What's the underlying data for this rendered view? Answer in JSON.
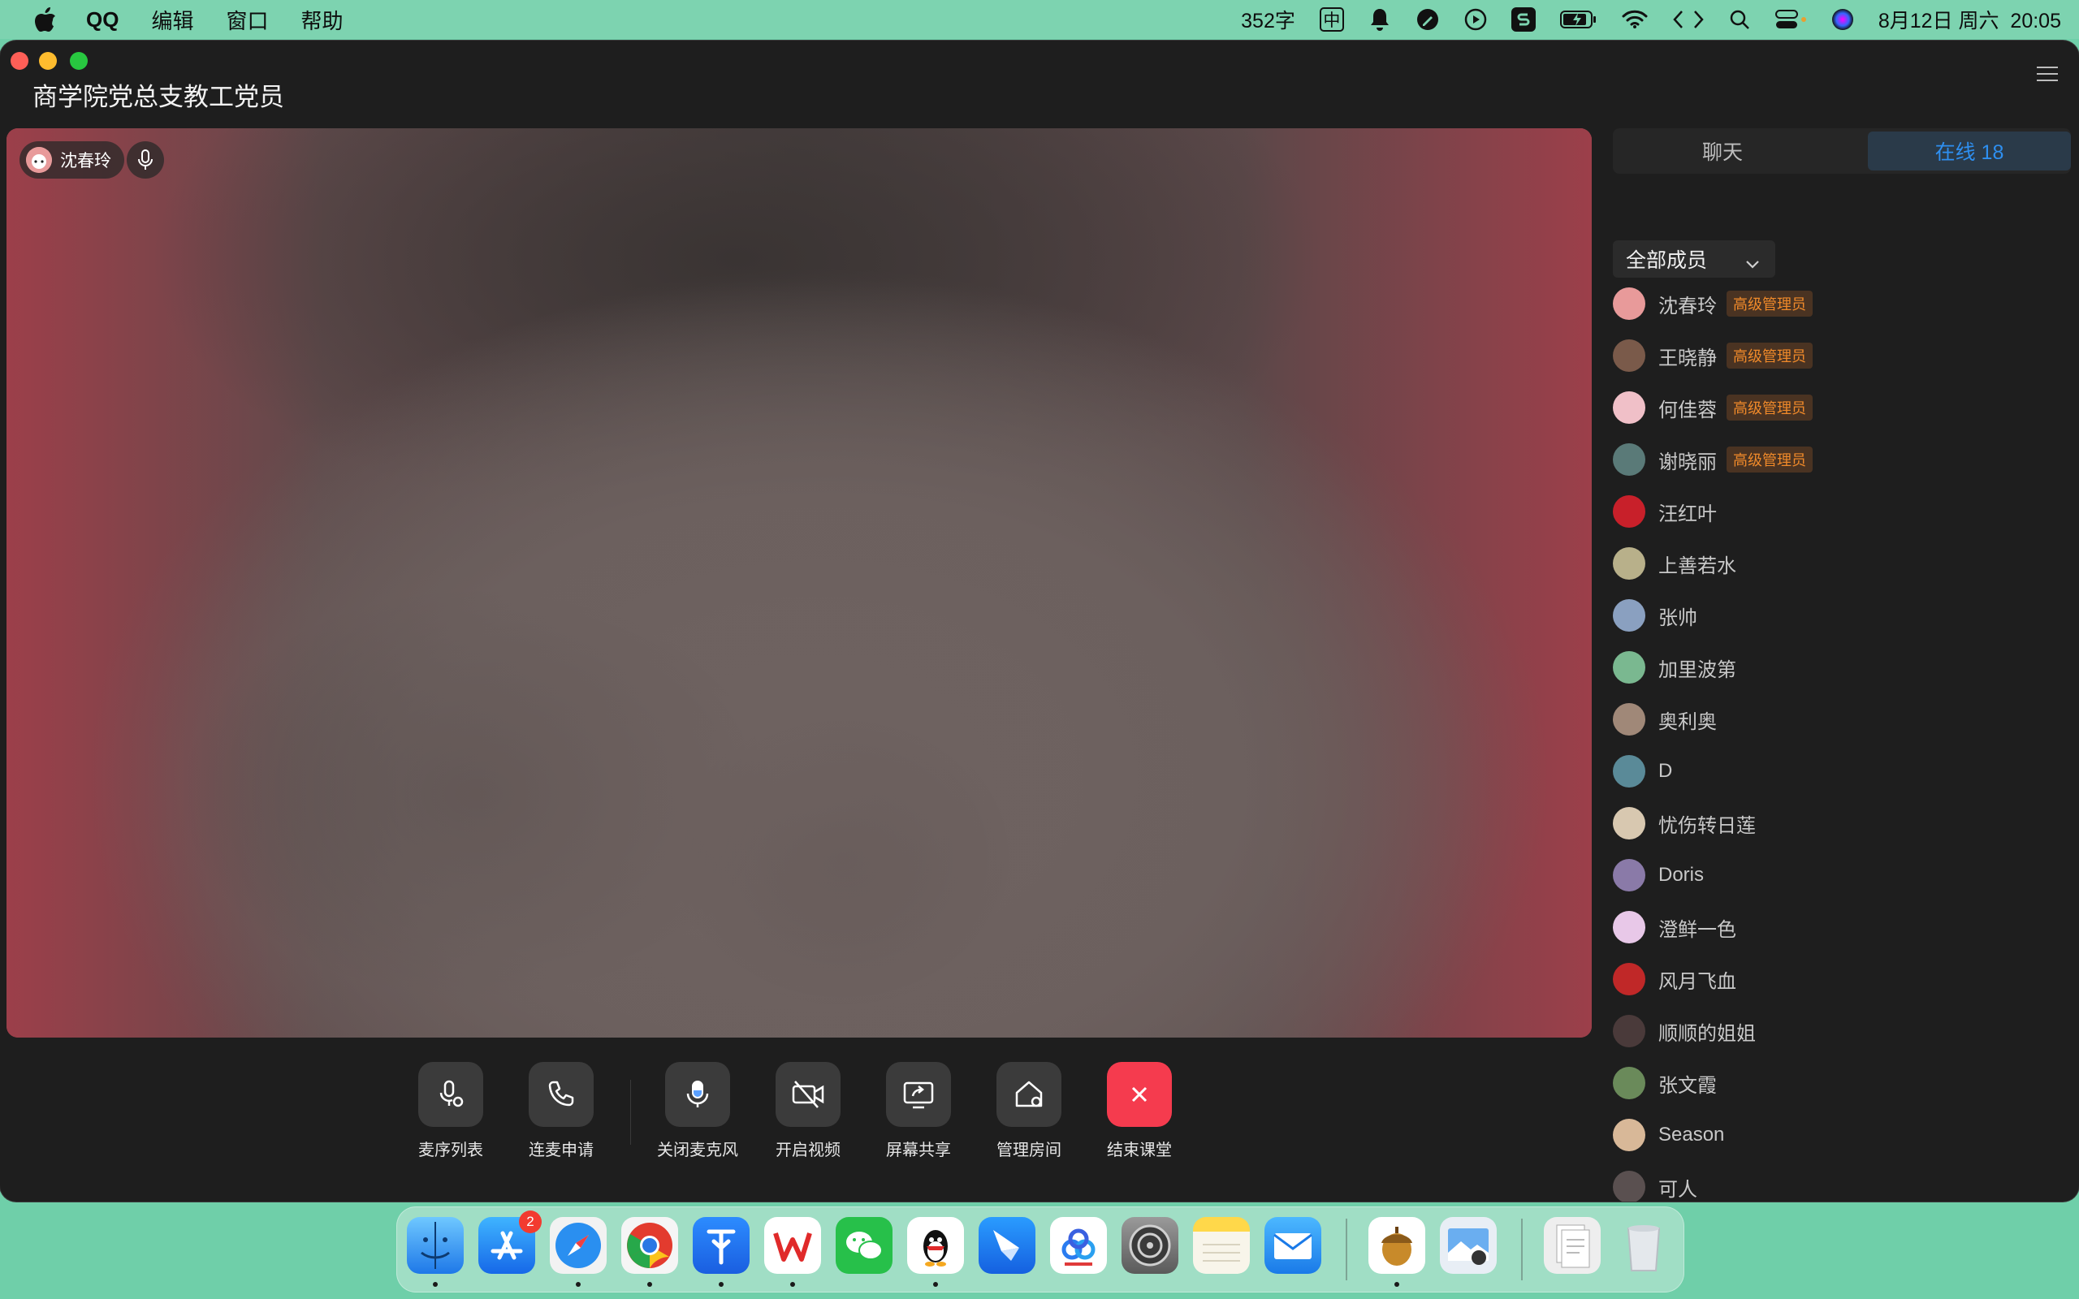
{
  "menubar": {
    "app_name": "QQ",
    "menus": [
      "编辑",
      "窗口",
      "帮助"
    ],
    "word_count": "352字",
    "input_method": "中",
    "datetime": "8月12日 周六  20:05"
  },
  "window": {
    "title": "商学院党总支教工党员"
  },
  "video": {
    "speaker_name": "沈春玲"
  },
  "controls": [
    {
      "label": "麦序列表",
      "icon": "mic-list-icon"
    },
    {
      "label": "连麦申请",
      "icon": "phone-icon"
    },
    {
      "label": "关闭麦克风",
      "icon": "microphone-icon"
    },
    {
      "label": "开启视频",
      "icon": "video-off-icon"
    },
    {
      "label": "屏幕共享",
      "icon": "screen-share-icon"
    },
    {
      "label": "管理房间",
      "icon": "manage-room-icon"
    },
    {
      "label": "结束课堂",
      "icon": "close-icon"
    }
  ],
  "side": {
    "tab_chat": "聊天",
    "tab_online": "在线 18",
    "filter": "全部成员",
    "admin_tag": "高级管理员",
    "members": [
      {
        "name": "沈春玲",
        "admin": true,
        "color": "#e89a9a"
      },
      {
        "name": "王晓静",
        "admin": true,
        "color": "#7a5a4a"
      },
      {
        "name": "何佳蓉",
        "admin": true,
        "color": "#f0c0c8"
      },
      {
        "name": "谢晓丽",
        "admin": true,
        "color": "#5a7a78"
      },
      {
        "name": "汪红叶",
        "admin": false,
        "color": "#c8202a"
      },
      {
        "name": "上善若水",
        "admin": false,
        "color": "#b8b08a"
      },
      {
        "name": "张帅",
        "admin": false,
        "color": "#8aa0c0"
      },
      {
        "name": "加里波第",
        "admin": false,
        "color": "#7ab890"
      },
      {
        "name": "奥利奥",
        "admin": false,
        "color": "#a08878"
      },
      {
        "name": "D",
        "admin": false,
        "color": "#5a8a98"
      },
      {
        "name": "忧伤转日莲",
        "admin": false,
        "color": "#d8c8b0"
      },
      {
        "name": "Doris",
        "admin": false,
        "color": "#8a7aa8"
      },
      {
        "name": "澄鲜一色",
        "admin": false,
        "color": "#e8c8e8"
      },
      {
        "name": "风月飞血",
        "admin": false,
        "color": "#c02828"
      },
      {
        "name": "顺顺的姐姐",
        "admin": false,
        "color": "#4a3a3a"
      },
      {
        "name": "张文霞",
        "admin": false,
        "color": "#6a8a5a"
      },
      {
        "name": "Season",
        "admin": false,
        "color": "#d8b898"
      },
      {
        "name": "可人",
        "admin": false,
        "color": "#5a5050"
      }
    ]
  },
  "dock": {
    "app_store_badge": "2",
    "apps": [
      "finder",
      "app-store",
      "safari",
      "chrome",
      "testflight",
      "wps",
      "wechat",
      "qq",
      "feishu",
      "baidu-netdisk",
      "system-settings",
      "notes",
      "mail",
      "squirrel",
      "preview",
      "documents",
      "trash"
    ]
  }
}
